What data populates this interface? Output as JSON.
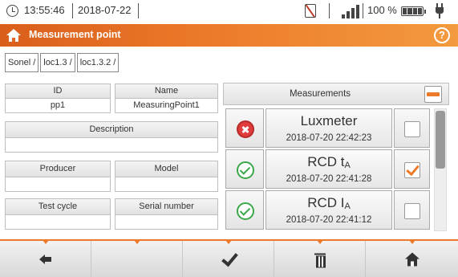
{
  "status": {
    "time": "13:55:46",
    "date": "2018-07-22",
    "battery_percent": "100 %",
    "icons": [
      "clock-icon",
      "no-sim-icon",
      "signal-icon",
      "battery-icon",
      "plug-icon"
    ]
  },
  "header": {
    "title": "Measurement point",
    "help_symbol": "?",
    "background_color": "#ec7a2a"
  },
  "breadcrumb": [
    "Sonel /",
    "loc1.3 /",
    "loc1.3.2 /"
  ],
  "fields": {
    "id": {
      "label": "ID",
      "value": "pp1"
    },
    "name": {
      "label": "Name",
      "value": "MeasuringPoint1"
    },
    "description": {
      "label": "Description",
      "value": ""
    },
    "producer": {
      "label": "Producer",
      "value": ""
    },
    "model": {
      "label": "Model",
      "value": ""
    },
    "test_cycle": {
      "label": "Test cycle",
      "value": ""
    },
    "serial_number": {
      "label": "Serial number",
      "value": ""
    }
  },
  "measurements": {
    "title": "Measurements",
    "items": [
      {
        "name": "Luxmeter",
        "sub": "",
        "timestamp": "2018-07-20 22:42:23",
        "status": "fail",
        "checked": false
      },
      {
        "name": "RCD t",
        "sub": "A",
        "timestamp": "2018-07-20 22:41:28",
        "status": "ok",
        "checked": true
      },
      {
        "name": "RCD I",
        "sub": "A",
        "timestamp": "2018-07-20 22:41:12",
        "status": "ok",
        "checked": false
      }
    ]
  },
  "toolbar": {
    "buttons": [
      "back-icon",
      "",
      "check-icon",
      "trash-icon",
      "home-icon"
    ],
    "accent_color": "#ec7a2a"
  }
}
